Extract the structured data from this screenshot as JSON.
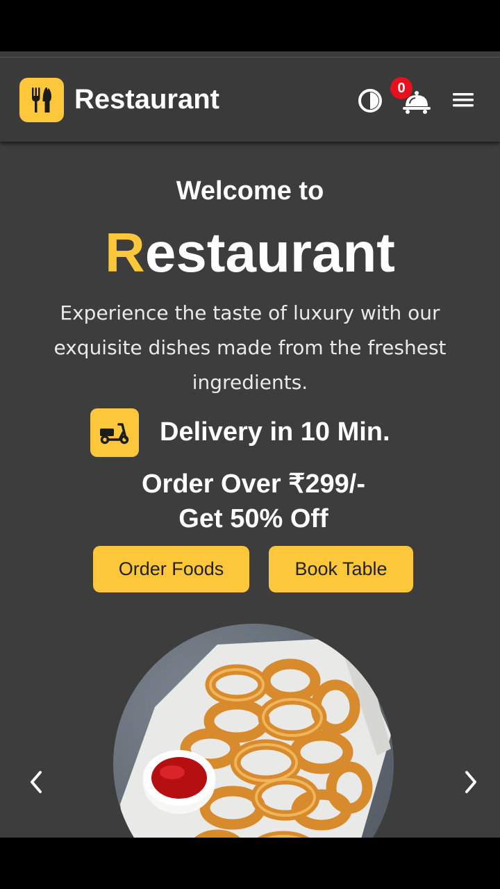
{
  "header": {
    "brand": "Restaurant",
    "logo_icon": "utensils-icon",
    "theme_icon": "contrast-icon",
    "cart_icon": "food-cloche-icon",
    "cart_count": "0",
    "menu_icon": "hamburger-menu-icon"
  },
  "hero": {
    "welcome": "Welcome to",
    "title_first_letter": "R",
    "title_rest": "estaurant",
    "description": "Experience the taste of luxury with our exquisite dishes made from the freshest ingredients.",
    "delivery_icon": "scooter-icon",
    "delivery_text": "Delivery in 10 Min.",
    "offer_line1": "Order Over ₹299/-",
    "offer_line2": "Get 50% Off",
    "order_button": "Order Foods",
    "book_button": "Book Table"
  },
  "carousel": {
    "image_subject": "onion rings with ketchup",
    "prev_icon": "chevron-left-icon",
    "next_icon": "chevron-right-icon"
  },
  "colors": {
    "accent": "#fcc73a",
    "background": "#3d3d3d",
    "badge": "#e8101c"
  }
}
